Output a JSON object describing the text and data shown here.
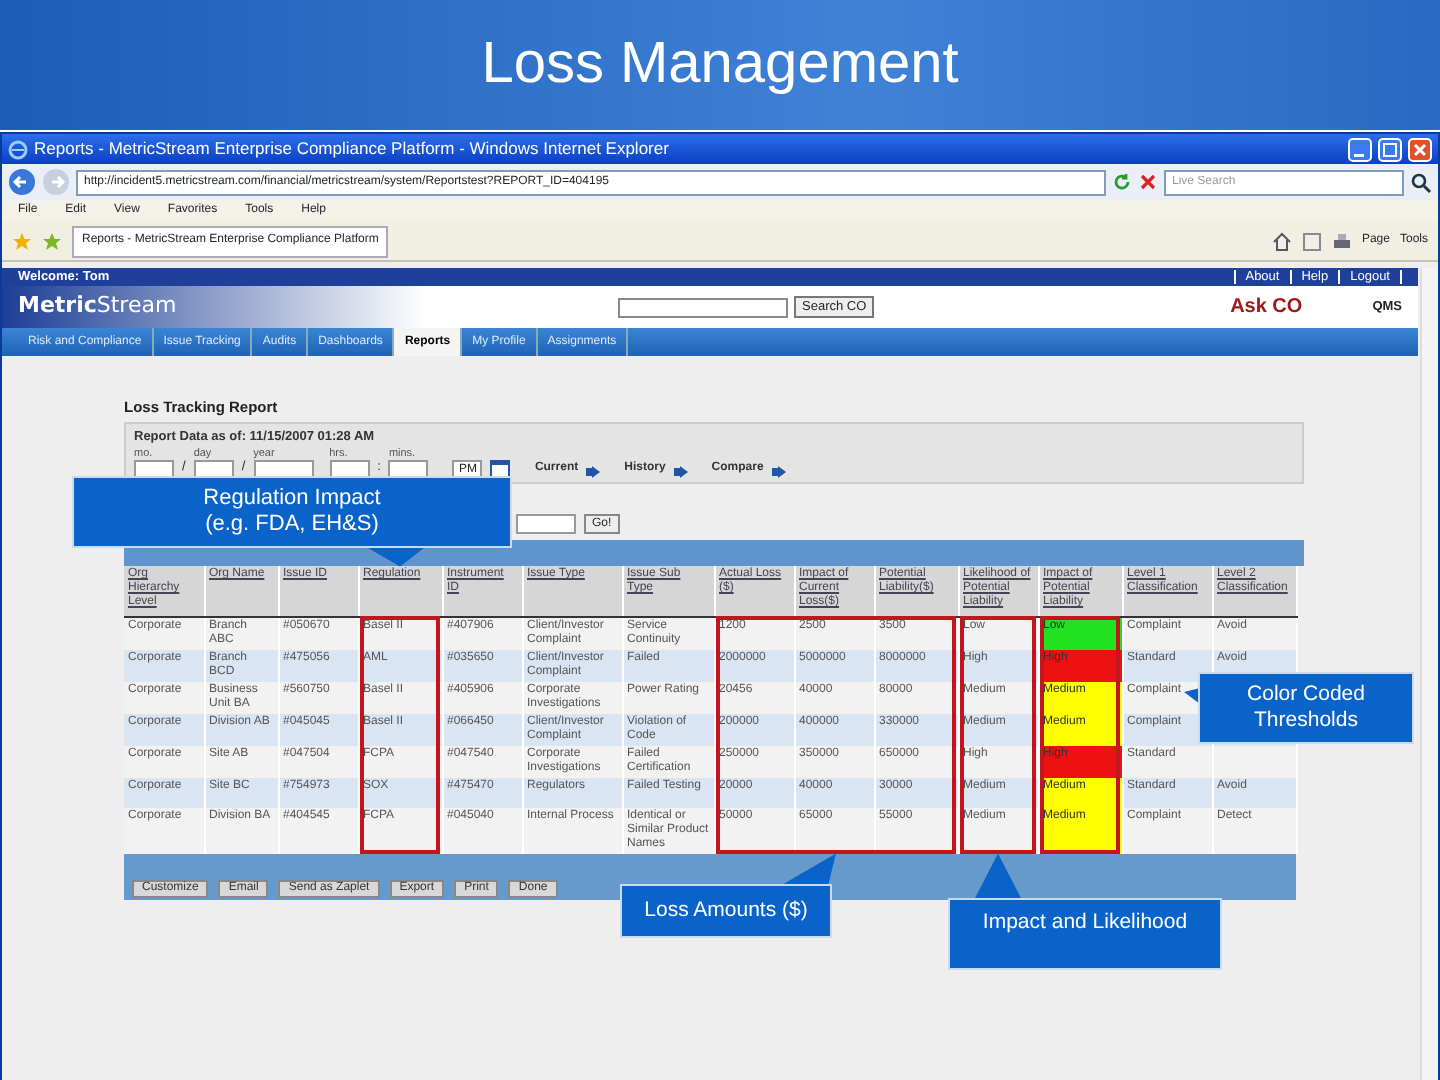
{
  "slide_title": "Loss Management",
  "browser": {
    "title": "Reports - MetricStream Enterprise Compliance Platform - Windows Internet Explorer",
    "url": "http://incident5.metricstream.com/financial/metricstream/system/Reportstest?REPORT_ID=404195",
    "search_placeholder": "Live Search",
    "menu": [
      "File",
      "Edit",
      "View",
      "Favorites",
      "Tools",
      "Help"
    ],
    "tab": "Reports - MetricStream Enterprise Compliance Platform",
    "toolbar": [
      "Page",
      "Tools"
    ]
  },
  "app": {
    "welcome": "Welcome: Tom",
    "links": [
      "About",
      "Help",
      "Logout"
    ],
    "logo_bold": "Metric",
    "logo_rest": "Stream",
    "search_button": "Search CO",
    "ask": "Ask CO",
    "product": "QMS",
    "nav": [
      {
        "label": "Risk and Compliance",
        "selected": false
      },
      {
        "label": "Issue Tracking",
        "selected": false
      },
      {
        "label": "Audits",
        "selected": false
      },
      {
        "label": "Dashboards",
        "selected": false
      },
      {
        "label": "Reports",
        "selected": true
      },
      {
        "label": "My Profile",
        "selected": false
      },
      {
        "label": "Assignments",
        "selected": false
      }
    ]
  },
  "report": {
    "title": "Loss Tracking Report",
    "as_of": "Report Data as of: 11/15/2007 01:28 AM",
    "date_fields": [
      {
        "label": "mo.",
        "sep": "/"
      },
      {
        "label": "day",
        "sep": "/"
      },
      {
        "label": "year"
      },
      {
        "label": "hrs.",
        "sep": ":"
      },
      {
        "label": "mins."
      }
    ],
    "ampm": "PM",
    "views": [
      "Current",
      "History",
      "Compare"
    ],
    "go": "Go!",
    "columns": [
      {
        "label": "Org Hierarchy Level",
        "kind": "text"
      },
      {
        "label": "Org Name",
        "kind": "text"
      },
      {
        "label": "Issue ID",
        "kind": "text"
      },
      {
        "label": "Regulation",
        "kind": "text",
        "boxed": true,
        "callout": {
          "text": "Regulation Impact\n(e.g. FDA, EH&S)",
          "kind": "top-left"
        }
      },
      {
        "label": "Instrument ID",
        "kind": "text"
      },
      {
        "label": "Issue Type",
        "kind": "text"
      },
      {
        "label": "Issue Sub Type",
        "kind": "text"
      },
      {
        "label": "Actual Loss ($)",
        "kind": "text",
        "boxed": true,
        "callout": {
          "text": "Loss Amounts ($)",
          "kind": "bottom"
        }
      },
      {
        "label": "Impact of Current Loss($)",
        "kind": "text",
        "boxed": true,
        "joined": true
      },
      {
        "label": "Potential Liability($)",
        "kind": "text",
        "boxed": true,
        "joined": true
      },
      {
        "label": "Likelihood of Potential Liability",
        "kind": "text",
        "boxed": true,
        "callout": {
          "text": "Impact and Likelihood",
          "kind": "bottom-right"
        }
      },
      {
        "label": "Impact of Potential Liability",
        "kind": "impact",
        "boxed": true,
        "callout": {
          "text": "Color Coded\nThresholds",
          "kind": "right"
        }
      },
      {
        "label": "Level 1 Classification",
        "kind": "text"
      },
      {
        "label": "Level 2 Classification",
        "kind": "text"
      }
    ],
    "rows": [
      {
        "cells": [
          "Corporate",
          "Branch ABC",
          "#050670",
          "Basel II",
          "#407906",
          "Client/Investor Complaint",
          "Service Continuity",
          "1200",
          "2500",
          "3500",
          "Low",
          "Low",
          "Complaint",
          "Avoid"
        ],
        "color": "#22e022"
      },
      {
        "cells": [
          "Corporate",
          "Branch BCD",
          "#475056",
          "AML",
          "#035650",
          "Client/Investor Complaint",
          "Failed",
          "2000000",
          "5000000",
          "8000000",
          "High",
          "High",
          "Standard",
          "Avoid"
        ],
        "color": "#ee1111"
      },
      {
        "cells": [
          "Corporate",
          "Business Unit BA",
          "#560750",
          "Basel II",
          "#405906",
          "Corporate Investigations",
          "Power Rating",
          "20456",
          "40000",
          "80000",
          "Medium",
          "Medium",
          "Complaint",
          null
        ],
        "color": "#ffff00"
      },
      {
        "cells": [
          "Corporate",
          "Division AB",
          "#045045",
          "Basel II",
          "#066450",
          "Client/Investor Complaint",
          "Violation of Code",
          "200000",
          "400000",
          "330000",
          "Medium",
          "Medium",
          "Complaint",
          null
        ],
        "color": "#ffff00"
      },
      {
        "cells": [
          "Corporate",
          "Site AB",
          "#047504",
          "FCPA",
          "#047540",
          "Corporate Investigations",
          "Failed Certification",
          "250000",
          "350000",
          "650000",
          "High",
          "High",
          "Standard",
          null
        ],
        "color": "#ee1111"
      },
      {
        "cells": [
          "Corporate",
          "Site BC",
          "#754973",
          "SOX",
          "#475470",
          "Regulators",
          "Failed Testing",
          "20000",
          "40000",
          "30000",
          "Medium",
          "Medium",
          "Standard",
          "Avoid"
        ],
        "color": "#ffff00"
      },
      {
        "cells": [
          "Corporate",
          "Division BA",
          "#404545",
          "FCPA",
          "#045040",
          "Internal Process",
          "Identical or Similar Product Names",
          "50000",
          "65000",
          "55000",
          "Medium",
          "Medium",
          "Complaint",
          "Detect"
        ],
        "color": "#ffff00"
      }
    ],
    "buttons": [
      "Customize",
      "Email",
      "Send as Zaplet",
      "Export",
      "Print",
      "Done"
    ]
  }
}
